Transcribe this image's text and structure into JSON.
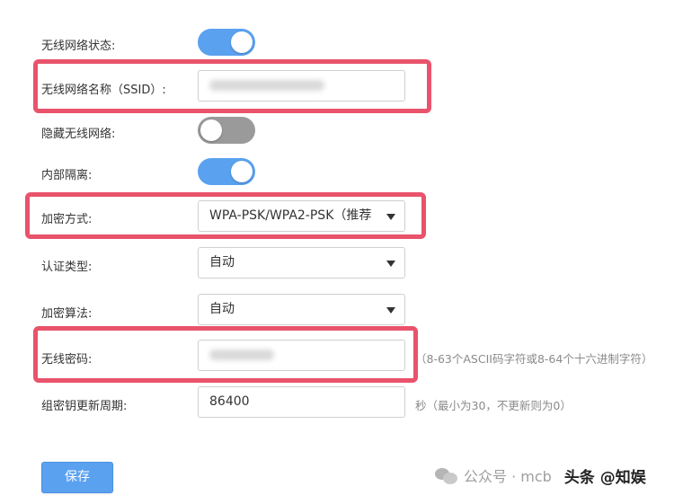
{
  "form": {
    "wireless_status_label": "无线网络状态:",
    "ssid_label": "无线网络名称（SSID）:",
    "hide_network_label": "隐藏无线网络:",
    "isolation_label": "内部隔离:",
    "encryption_label": "加密方式:",
    "encryption_value": "WPA-PSK/WPA2-PSK（推荐",
    "auth_type_label": "认证类型:",
    "auth_type_value": "自动",
    "algorithm_label": "加密算法:",
    "algorithm_value": "自动",
    "password_label": "无线密码:",
    "password_hint": "（8-63个ASCII码字符或8-64个十六进制字符）",
    "group_key_label": "组密钥更新周期:",
    "group_key_value": "86400",
    "group_key_hint": "秒（最小为30，不更新则为0）",
    "save_label": "保存"
  },
  "toggles": {
    "wireless_status": "on",
    "hide_network": "off",
    "isolation": "on"
  },
  "watermark": {
    "text": "公众号 · mcb",
    "brand": "头条 @知娱"
  },
  "colors": {
    "accent": "#5aa1f0",
    "highlight": "#e9536b",
    "toggle_off": "#9a9a9a"
  }
}
